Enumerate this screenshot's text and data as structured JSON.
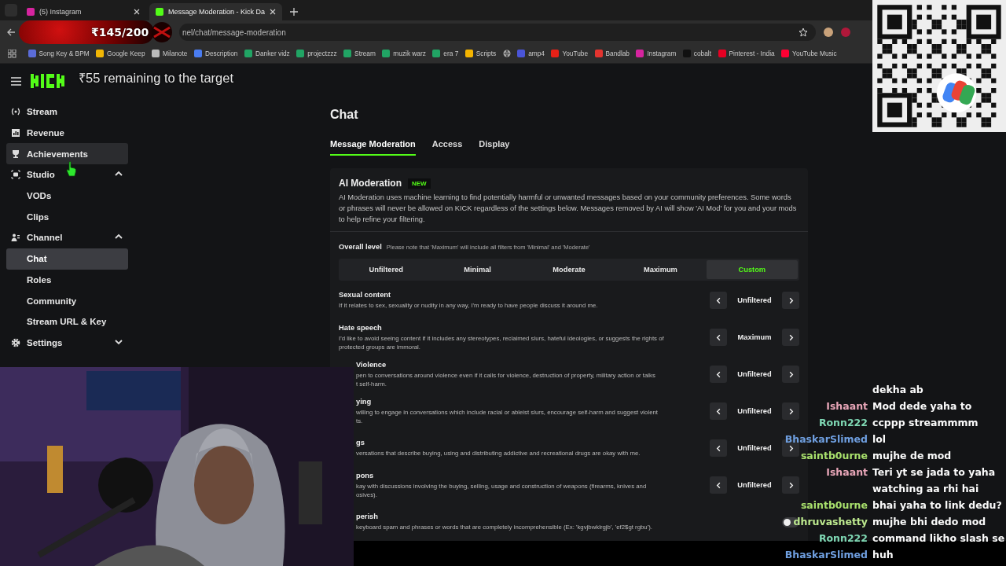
{
  "browser": {
    "tabs": [
      {
        "title": "(5) Instagram",
        "selected": false
      },
      {
        "title": "Message Moderation - Kick Da",
        "selected": true
      }
    ],
    "url": "nel/chat/message-moderation",
    "bookmarks": [
      {
        "kind": "link",
        "label": "Song Key & BPM",
        "color": "#5b6cd8"
      },
      {
        "kind": "link",
        "label": "Google Keep",
        "color": "#f2b705"
      },
      {
        "kind": "link",
        "label": "Milanote",
        "color": "#bbbbbb"
      },
      {
        "kind": "link",
        "label": "Description",
        "color": "#4a7cf0"
      },
      {
        "kind": "link",
        "label": "Danker vidz",
        "color": "#21a464"
      },
      {
        "kind": "link",
        "label": "projectzzz",
        "color": "#21a464"
      },
      {
        "kind": "link",
        "label": "Stream",
        "color": "#21a464"
      },
      {
        "kind": "link",
        "label": "muzik warz",
        "color": "#21a464"
      },
      {
        "kind": "link",
        "label": "era 7",
        "color": "#21a464"
      },
      {
        "kind": "link",
        "label": "Scripts",
        "color": "#f4b400"
      },
      {
        "kind": "globe"
      },
      {
        "kind": "link",
        "label": "amp4",
        "color": "#4a55d8"
      },
      {
        "kind": "link",
        "label": "YouTube",
        "color": "#e62117"
      },
      {
        "kind": "link",
        "label": "Bandlab",
        "color": "#e3342f"
      },
      {
        "kind": "link",
        "label": "Instagram",
        "color": "#d6249f"
      },
      {
        "kind": "link",
        "label": "cobalt",
        "color": "#111111"
      },
      {
        "kind": "link",
        "label": "Pinterest - India",
        "color": "#e60023"
      },
      {
        "kind": "link",
        "label": "YouTube Music",
        "color": "#ff0033"
      }
    ]
  },
  "sidebar": {
    "items": [
      {
        "label": "Stream",
        "hovered": false,
        "selected": false
      },
      {
        "label": "Revenue",
        "hovered": false,
        "selected": false
      },
      {
        "label": "Achievements",
        "hovered": true,
        "selected": false
      },
      {
        "label": "Studio",
        "hovered": false,
        "selected": false,
        "expanded": true,
        "children": [
          {
            "label": "VODs",
            "selected": false
          },
          {
            "label": "Clips",
            "selected": false
          }
        ]
      },
      {
        "label": "Channel",
        "hovered": false,
        "selected": false,
        "expanded": true,
        "children": [
          {
            "label": "Chat",
            "selected": true
          },
          {
            "label": "Roles",
            "selected": false
          },
          {
            "label": "Community",
            "selected": false
          },
          {
            "label": "Stream URL & Key",
            "selected": false
          }
        ]
      },
      {
        "label": "Settings",
        "hovered": false,
        "selected": false,
        "expanded": false
      }
    ]
  },
  "page": {
    "title": "Chat",
    "tabs": [
      {
        "label": "Message Moderation",
        "selected": true
      },
      {
        "label": "Access",
        "selected": false
      },
      {
        "label": "Display",
        "selected": false
      }
    ],
    "card": {
      "title": "AI Moderation",
      "badge": "NEW",
      "description": "AI Moderation uses machine learning to find potentially harmful or unwanted messages based on your community preferences. Some words or phrases will never be allowed on KICK regardless of the settings below. Messages removed by AI will show 'AI Mod' for you and your mods to help refine your filtering.",
      "overall_label": "Overall level",
      "overall_note": "Please note that 'Maximum' will include all filters from 'Minimal' and 'Moderate'",
      "levels": [
        {
          "label": "Unfiltered",
          "selected": false
        },
        {
          "label": "Minimal",
          "selected": false
        },
        {
          "label": "Moderate",
          "selected": false
        },
        {
          "label": "Maximum",
          "selected": false
        },
        {
          "label": "Custom",
          "selected": true
        }
      ],
      "categories": [
        {
          "kind": "stepper",
          "partly_hidden": false,
          "title": "Sexual content",
          "description": "If it relates to sex, sexuality or nudity in any way, I'm ready to have people discuss it around me.",
          "value": "Unfiltered"
        },
        {
          "kind": "stepper",
          "partly_hidden": false,
          "title": "Hate speech",
          "description": "I'd like to avoid seeing content if it includes any stereotypes, reclaimed slurs, hateful ideologies, or suggests the rights of\nprotected groups are immoral.",
          "value": "Maximum"
        },
        {
          "kind": "stepper",
          "partly_hidden": true,
          "title": "Violence",
          "description": "pen to conversations around violence even if it calls for violence, destruction of property, military action or talks\nt self-harm.",
          "value": "Unfiltered"
        },
        {
          "kind": "stepper",
          "partly_hidden": true,
          "title": "ying",
          "description": "willing to engage in conversations which include racial or ableist slurs, encourage self-harm and suggest violent\nts.",
          "value": "Unfiltered"
        },
        {
          "kind": "stepper",
          "partly_hidden": true,
          "title": "gs",
          "description": "versations that describe buying, using and distributing addictive and recreational drugs are okay with me.",
          "value": "Unfiltered"
        },
        {
          "kind": "stepper",
          "partly_hidden": true,
          "title": "pons",
          "description": "kay with discussions involving the buying, selling, usage and construction of weapons (firearms, knives and\nosives).",
          "value": "Unfiltered"
        },
        {
          "kind": "toggle",
          "partly_hidden": true,
          "title": "perish",
          "description": "keyboard spam and phrases or words that are completely incomprehensible (Ex: 'kgvjbwklrgjb', 'ef2$gt rgbu').",
          "on": false
        }
      ]
    }
  },
  "overlays": {
    "goal": "₹145/200",
    "remaining": "₹55 remaining to the target",
    "chat": [
      {
        "text": "dekha ab"
      },
      {
        "user": "Ishaant",
        "color": "#e8a6b8",
        "text": "Mod dede yaha to"
      },
      {
        "user": "Ronn222",
        "color": "#7fd8b4",
        "text": "ccppp streammmm"
      },
      {
        "user": "BhaskarSlimed",
        "color": "#6f9fe0",
        "text": "lol"
      },
      {
        "user": "saintb0urne",
        "color": "#a8e06c",
        "text": "mujhe de mod"
      },
      {
        "user": "Ishaant",
        "color": "#e8a6b8",
        "text": "Teri yt se jada to yaha watching aa rhi hai"
      },
      {
        "user": "saintb0urne",
        "color": "#a8e06c",
        "text": "bhai yaha to link dedu?"
      },
      {
        "user": "dhruvashetty",
        "color": "#bce88e",
        "text": "mujhe bhi dedo mod"
      },
      {
        "user": "Ronn222",
        "color": "#7fd8b4",
        "text": "command likho slash se"
      },
      {
        "user": "BhaskarSlimed",
        "color": "#6f9fe0",
        "text": "huh"
      }
    ]
  }
}
